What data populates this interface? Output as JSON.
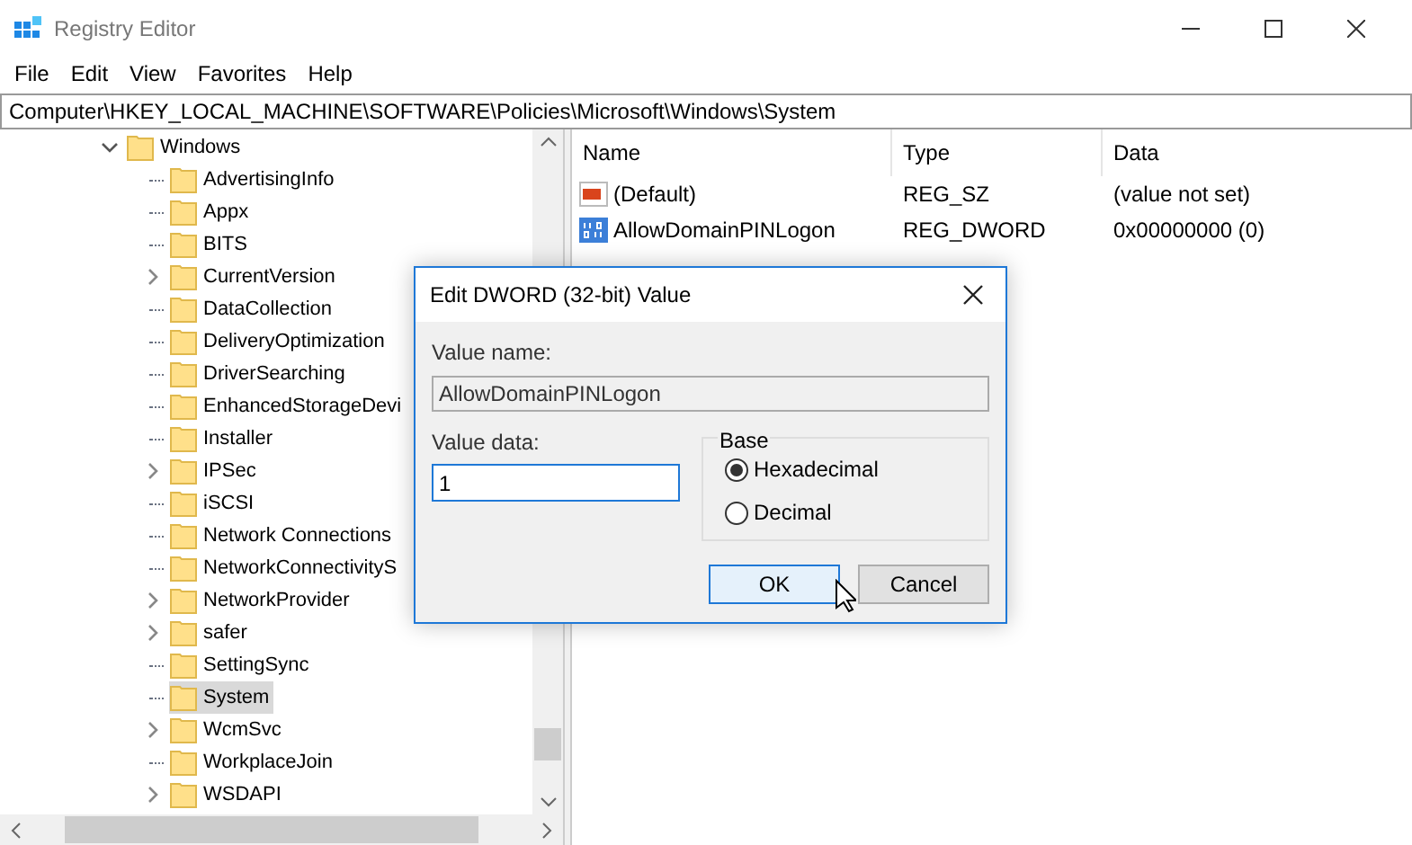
{
  "window": {
    "title": "Registry Editor"
  },
  "menu": [
    "File",
    "Edit",
    "View",
    "Favorites",
    "Help"
  ],
  "address": "Computer\\HKEY_LOCAL_MACHINE\\SOFTWARE\\Policies\\Microsoft\\Windows\\System",
  "tree": [
    {
      "label": "Windows",
      "kind": "expanded",
      "selected": false,
      "children": [
        {
          "label": "AdvertisingInfo",
          "kind": "leaf",
          "selected": false
        },
        {
          "label": "Appx",
          "kind": "leaf",
          "selected": false
        },
        {
          "label": "BITS",
          "kind": "leaf",
          "selected": false
        },
        {
          "label": "CurrentVersion",
          "kind": "collapsed",
          "selected": false
        },
        {
          "label": "DataCollection",
          "kind": "leaf",
          "selected": false
        },
        {
          "label": "DeliveryOptimization",
          "kind": "leaf",
          "selected": false
        },
        {
          "label": "DriverSearching",
          "kind": "leaf",
          "selected": false
        },
        {
          "label": "EnhancedStorageDevi",
          "kind": "leaf",
          "selected": false
        },
        {
          "label": "Installer",
          "kind": "leaf",
          "selected": false
        },
        {
          "label": "IPSec",
          "kind": "collapsed",
          "selected": false
        },
        {
          "label": "iSCSI",
          "kind": "leaf",
          "selected": false
        },
        {
          "label": "Network Connections",
          "kind": "leaf",
          "selected": false
        },
        {
          "label": "NetworkConnectivityS",
          "kind": "leaf",
          "selected": false
        },
        {
          "label": "NetworkProvider",
          "kind": "collapsed",
          "selected": false
        },
        {
          "label": "safer",
          "kind": "collapsed",
          "selected": false
        },
        {
          "label": "SettingSync",
          "kind": "leaf",
          "selected": false
        },
        {
          "label": "System",
          "kind": "leaf",
          "selected": true
        },
        {
          "label": "WcmSvc",
          "kind": "collapsed",
          "selected": false
        },
        {
          "label": "WorkplaceJoin",
          "kind": "leaf",
          "selected": false
        },
        {
          "label": "WSDAPI",
          "kind": "collapsed",
          "selected": false
        }
      ]
    }
  ],
  "list": {
    "columns": [
      "Name",
      "Type",
      "Data"
    ],
    "rows": [
      {
        "kind": "string",
        "name": "(Default)",
        "type": "REG_SZ",
        "data": "(value not set)"
      },
      {
        "kind": "dword",
        "name": "AllowDomainPINLogon",
        "type": "REG_DWORD",
        "data": "0x00000000 (0)"
      }
    ]
  },
  "dialog": {
    "title": "Edit DWORD (32-bit) Value",
    "name_label": "Value name:",
    "name_value": "AllowDomainPINLogon",
    "data_label": "Value data:",
    "data_value": "1",
    "base_label": "Base",
    "bases": [
      {
        "label": "Hexadecimal",
        "selected": true
      },
      {
        "label": "Decimal",
        "selected": false
      }
    ],
    "buttons": [
      {
        "label": "OK",
        "focused": true
      },
      {
        "label": "Cancel",
        "focused": false
      }
    ]
  }
}
